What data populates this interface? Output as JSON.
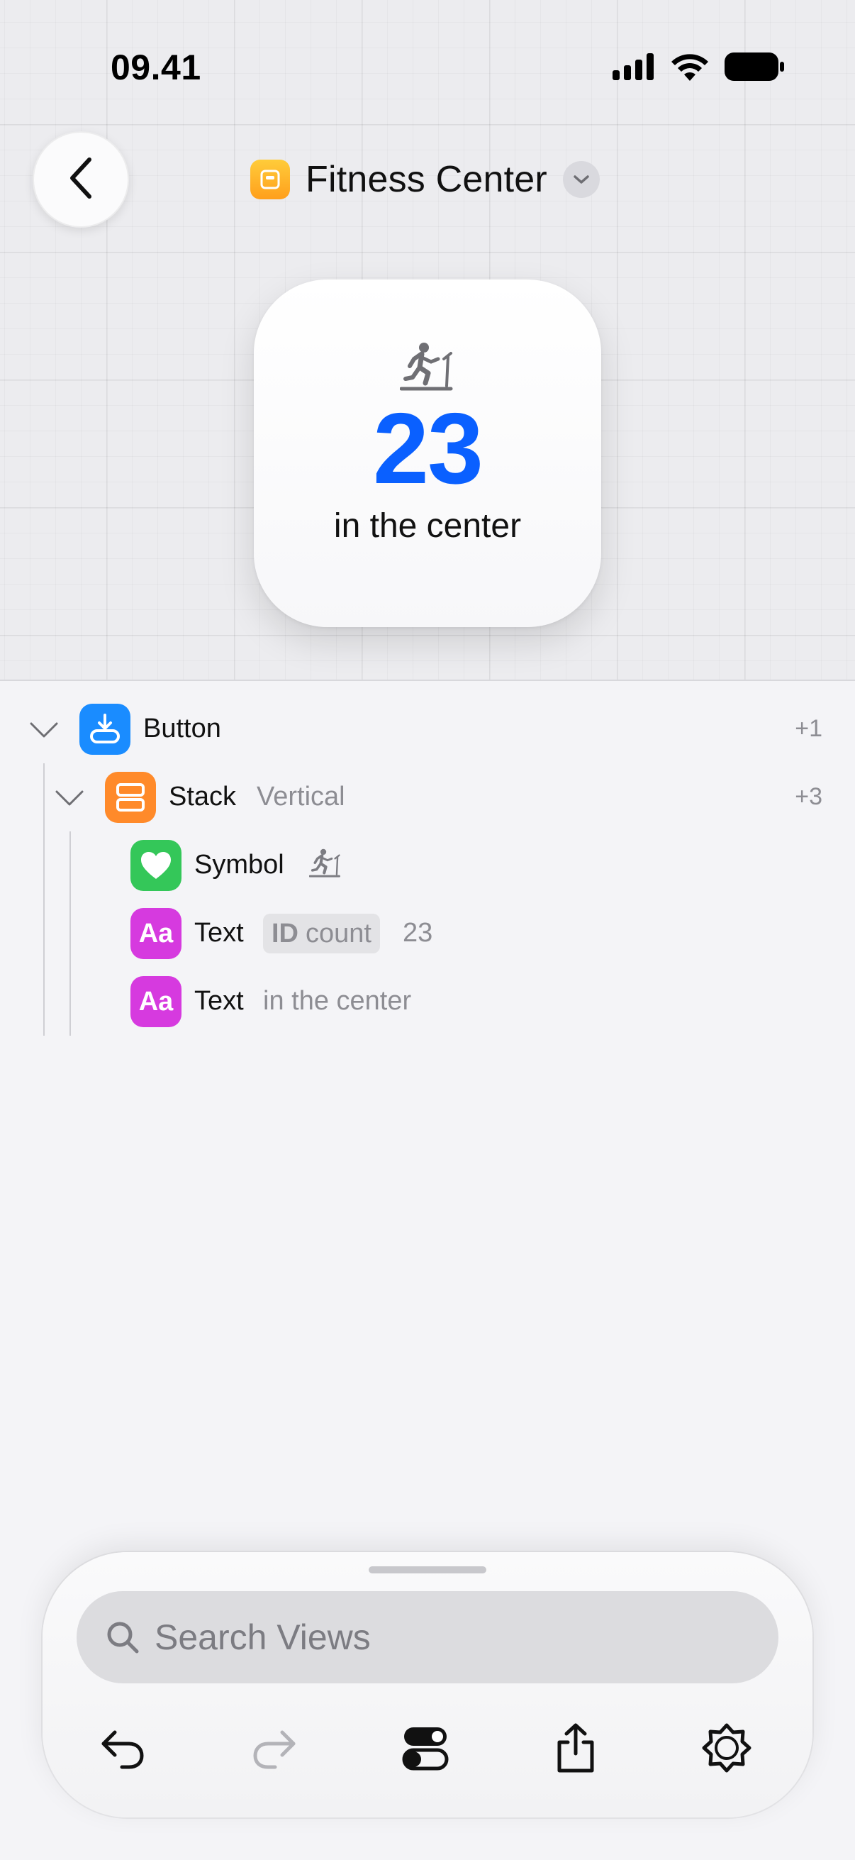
{
  "status_bar": {
    "time": "09.41",
    "icons": [
      "cellular-signal-icon",
      "wifi-icon",
      "battery-icon"
    ]
  },
  "header": {
    "back_icon": "chevron-left-icon",
    "title": "Fitness Center",
    "title_icon": "widget-app-icon",
    "dropdown_icon": "chevron-down-icon"
  },
  "preview": {
    "symbol": "figure-run-treadmill-icon",
    "count": "23",
    "caption": "in the center",
    "count_color": "#0a60ff"
  },
  "tree": [
    {
      "label": "Button",
      "detail": "",
      "count": "+1",
      "icon": "button-icon",
      "color": "#1a8cff"
    },
    {
      "label": "Stack",
      "detail": "Vertical",
      "count": "+3",
      "icon": "vstack-icon",
      "color": "#ff8a2a"
    },
    {
      "label": "Symbol",
      "detail": "",
      "icon": "heart-icon",
      "color": "#34c759",
      "symbol": "figure-run-treadmill-icon"
    },
    {
      "label": "Text",
      "id_prefix": "ID",
      "id_name": "count",
      "detail": "23",
      "icon_text": "Aa",
      "color": "#d63adf"
    },
    {
      "label": "Text",
      "detail": "in the center",
      "icon_text": "Aa",
      "color": "#d63adf"
    }
  ],
  "bottom_bar": {
    "search_placeholder": "Search Views",
    "search_value": "",
    "tools": [
      "undo-icon",
      "redo-icon",
      "toggles-icon",
      "share-icon",
      "settings-icon"
    ]
  }
}
